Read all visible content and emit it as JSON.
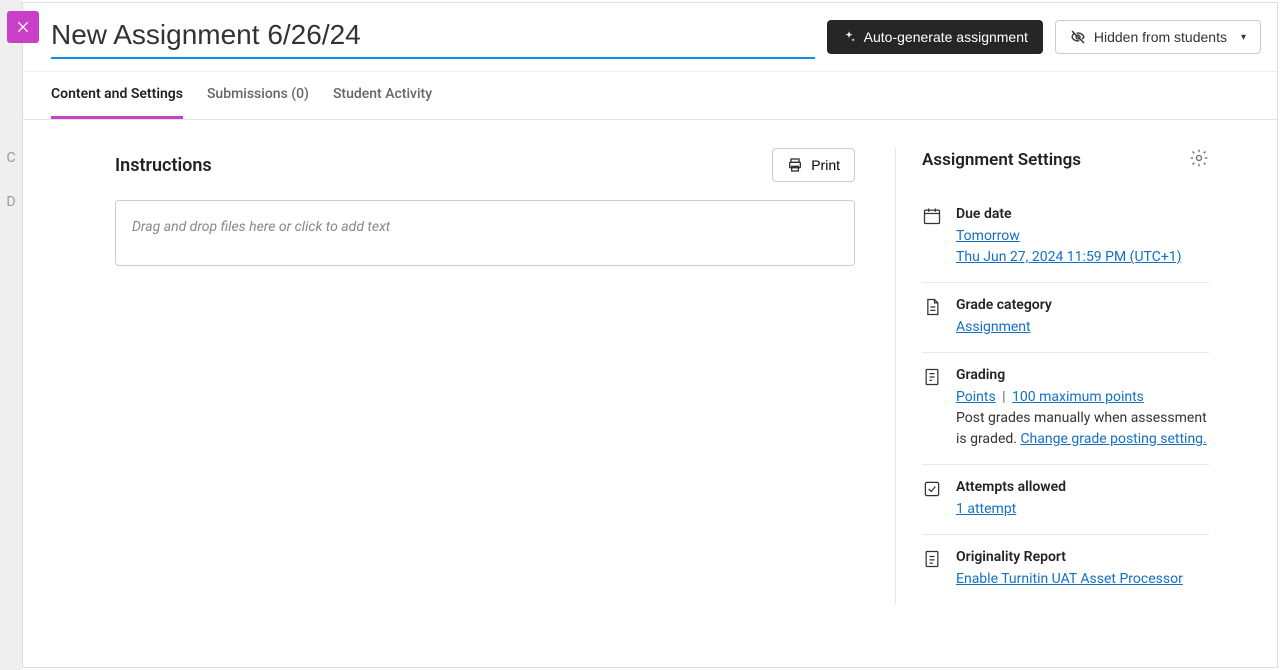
{
  "header": {
    "title": "New Assignment 6/26/24",
    "auto_generate": "Auto-generate assignment",
    "visibility": "Hidden from students"
  },
  "tabs": [
    {
      "label": "Content and Settings",
      "active": true
    },
    {
      "label": "Submissions (0)",
      "active": false
    },
    {
      "label": "Student Activity",
      "active": false
    }
  ],
  "main": {
    "instructions_heading": "Instructions",
    "print": "Print",
    "editor_placeholder": "Drag and drop files here or click to add text"
  },
  "sidebar": {
    "heading": "Assignment Settings",
    "due_date": {
      "title": "Due date",
      "relative": "Tomorrow",
      "absolute": "Thu Jun 27, 2024 11:59 PM (UTC+1)"
    },
    "grade_category": {
      "title": "Grade category",
      "value": "Assignment"
    },
    "grading": {
      "title": "Grading",
      "type": "Points",
      "max": "100 maximum points",
      "note_pre": "Post grades manually when assessment is graded. ",
      "change_link": "Change grade posting setting."
    },
    "attempts": {
      "title": "Attempts allowed",
      "value": "1 attempt"
    },
    "originality": {
      "title": "Originality Report",
      "value": "Enable Turnitin UAT Asset Processor"
    }
  }
}
